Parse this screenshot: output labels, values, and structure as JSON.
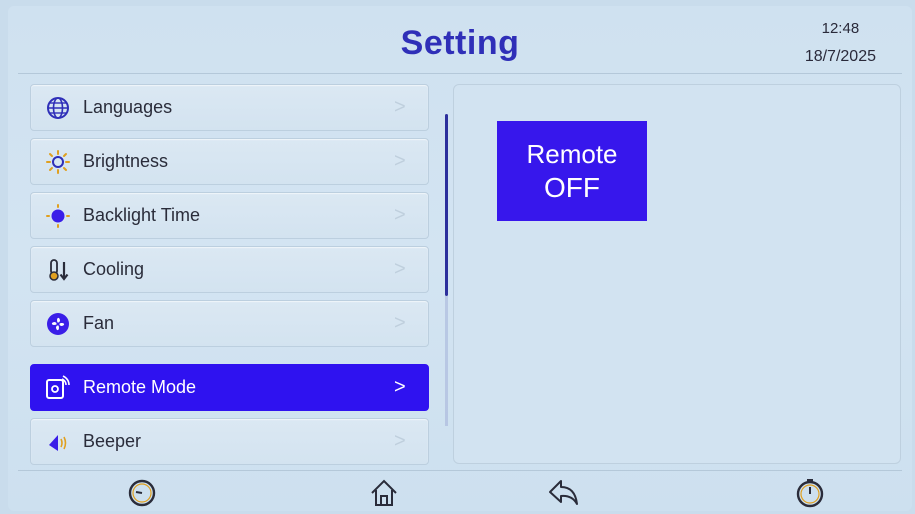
{
  "header": {
    "title": "Setting",
    "time": "12:48",
    "date": "18/7/2025"
  },
  "menu": {
    "items": [
      {
        "label": "Languages",
        "icon": "globe-icon"
      },
      {
        "label": "Brightness",
        "icon": "sun-icon"
      },
      {
        "label": "Backlight Time",
        "icon": "backlight-icon"
      },
      {
        "label": "Cooling",
        "icon": "thermometer-icon"
      },
      {
        "label": "Fan",
        "icon": "fan-icon"
      },
      {
        "label": "Remote Mode",
        "icon": "remote-icon",
        "active": true
      },
      {
        "label": "Beeper",
        "icon": "speaker-icon"
      }
    ],
    "chevron": ">"
  },
  "panel": {
    "remote_label": "Remote",
    "remote_state": "OFF"
  },
  "footer": {
    "buttons": [
      "clock-icon",
      "home-icon",
      "back-icon",
      "timer-icon"
    ]
  },
  "colors": {
    "accent": "#2f12f0",
    "title": "#2f2fb8",
    "background": "#cfe1f0"
  }
}
